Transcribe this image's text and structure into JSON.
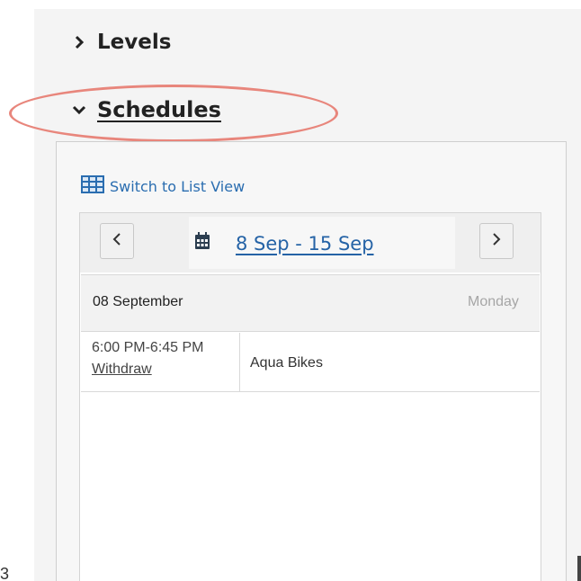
{
  "sections": {
    "levels": {
      "label": "Levels",
      "expanded": false
    },
    "schedules": {
      "label": "Schedules",
      "expanded": true
    }
  },
  "highlight": {
    "color": "#e8867c",
    "target": "Schedules"
  },
  "schedule": {
    "switch_view_label": "Switch to List View",
    "date_range": "8 Sep - 15 Sep",
    "prev_icon": "chevron-left-icon",
    "next_icon": "chevron-right-icon",
    "calendar_icon": "calendar-icon",
    "link_color": "#2563a6",
    "days": [
      {
        "date": "08 September",
        "weekday": "Monday",
        "events": [
          {
            "time": "6:00 PM-6:45 PM",
            "action": "Withdraw",
            "name": "Aqua Bikes"
          }
        ]
      }
    ]
  },
  "page_number": "3"
}
